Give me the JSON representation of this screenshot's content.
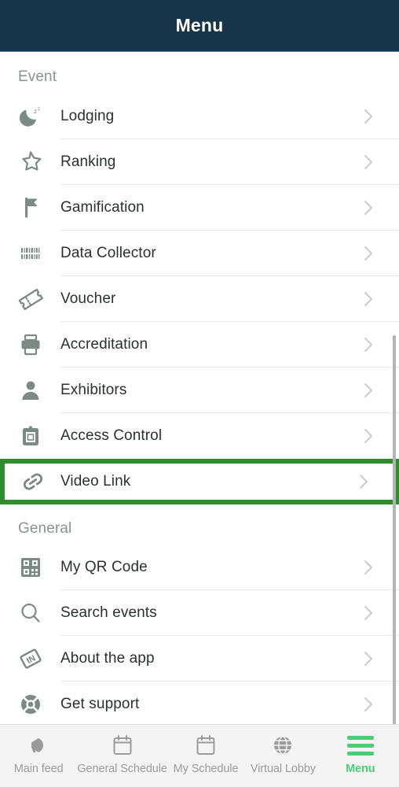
{
  "header": {
    "title": "Menu"
  },
  "sections": [
    {
      "title": "Event",
      "items": [
        {
          "label": "Lodging",
          "icon": "moon-sleep-icon"
        },
        {
          "label": "Ranking",
          "icon": "star-outline-icon"
        },
        {
          "label": "Gamification",
          "icon": "flag-icon"
        },
        {
          "label": "Data Collector",
          "icon": "barcode-icon"
        },
        {
          "label": "Voucher",
          "icon": "ticket-icon"
        },
        {
          "label": "Accreditation",
          "icon": "printer-icon"
        },
        {
          "label": "Exhibitors",
          "icon": "person-icon"
        },
        {
          "label": "Access Control",
          "icon": "clipboard-badge-icon"
        },
        {
          "label": "Video Link",
          "icon": "link-chain-icon",
          "highlighted": true
        }
      ]
    },
    {
      "title": "General",
      "items": [
        {
          "label": "My QR Code",
          "icon": "qr-code-icon"
        },
        {
          "label": "Search events",
          "icon": "magnifier-icon"
        },
        {
          "label": "About the app",
          "icon": "in-logo-icon"
        },
        {
          "label": "Get support",
          "icon": "life-buoy-icon"
        }
      ]
    }
  ],
  "bottom_nav": {
    "items": [
      {
        "label": "Main feed",
        "icon": "megaphone-icon",
        "active": false
      },
      {
        "label": "General Schedule",
        "icon": "calendar-icon",
        "active": false
      },
      {
        "label": "My Schedule",
        "icon": "calendar-icon",
        "active": false
      },
      {
        "label": "Virtual Lobby",
        "icon": "globe-icon",
        "active": false
      },
      {
        "label": "Menu",
        "icon": "hamburger-icon",
        "active": true
      }
    ]
  },
  "colors": {
    "header_bg": "#153349",
    "icon_gray": "#7c8a84",
    "accent_green": "#4ecb79",
    "annotation_green": "#2e8b2e",
    "text": "#2c2f33",
    "muted": "#8b9196"
  }
}
